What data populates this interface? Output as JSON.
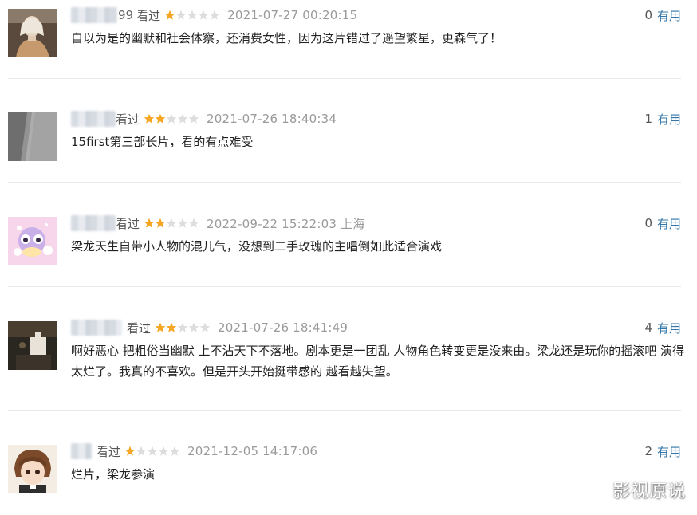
{
  "comments": [
    {
      "name_tail": "99",
      "watched": "看过",
      "rating": 1,
      "time": "2021-07-27 00:20:15",
      "useful_count": "0",
      "useful_label": "有用",
      "text": "自以为是的幽默和社会体察，还消费女性，因为这片错过了遥望繁星，更森气了！"
    },
    {
      "name_tail": "",
      "watched": "看过",
      "rating": 2,
      "time": "2021-07-26 18:40:34",
      "useful_count": "1",
      "useful_label": "有用",
      "text": "15first第三部长片，看的有点难受"
    },
    {
      "name_tail": "",
      "watched": "看过",
      "rating": 2,
      "time": "2022-09-22 15:22:03 上海",
      "useful_count": "0",
      "useful_label": "有用",
      "text": "梁龙天生自带小人物的混儿气，没想到二手玫瑰的主唱倒如此适合演戏"
    },
    {
      "name_tail": "",
      "watched": "看过",
      "rating": 2,
      "time": "2021-07-26 18:41:49",
      "useful_count": "4",
      "useful_label": "有用",
      "text": "啊好恶心 把粗俗当幽默 上不沾天下不落地。剧本更是一团乱 人物角色转变更是没来由。梁龙还是玩你的摇滚吧 演得太烂了。我真的不喜欢。但是开头开始挺带感的 越看越失望。"
    },
    {
      "name_tail": "",
      "watched": "看过",
      "rating": 1,
      "time": "2021-12-05 14:17:06",
      "useful_count": "2",
      "useful_label": "有用",
      "text": "烂片，梁龙参演"
    }
  ],
  "watermark": "影视原说",
  "colors": {
    "star_on": "#f5a623",
    "star_off": "#dddddd",
    "link": "#3377aa"
  }
}
